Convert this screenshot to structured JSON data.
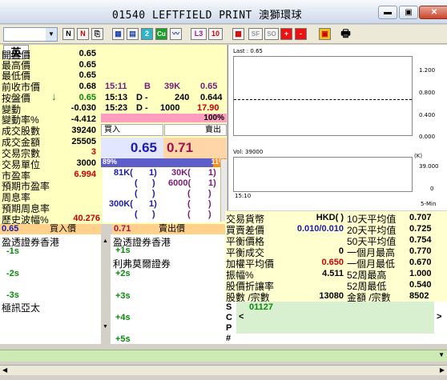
{
  "window": {
    "title": "01540 LEFTFIELD PRINT 澳獅環球",
    "min": "▬",
    "max": "▣",
    "close": "✕"
  },
  "toolbar": {
    "lang_tab": "英",
    "buttons": [
      "N",
      "⎘",
      "▦",
      "▤",
      "2",
      "Cu",
      "〰",
      "L3",
      "10",
      "▩",
      "SF",
      "SO",
      "+",
      "-",
      "▣",
      "🖶"
    ]
  },
  "quote": {
    "labels": [
      "開盤價",
      "最高價",
      "最低價",
      "前收市價",
      "按盤價",
      "變動",
      "變動率%",
      "成交股數",
      "成交金額",
      "交易宗數",
      "交易單位",
      "市盈率",
      "預期市盈率",
      "周息率",
      "預期周息率",
      "歷史波幅%"
    ],
    "values": [
      "0.65",
      "0.65",
      "0.65",
      "0.68",
      "0.65",
      "-0.030",
      "-4.412",
      "39240",
      "25505",
      "3",
      "3000",
      "6.994",
      "",
      "",
      "",
      "40.276"
    ],
    "trend_arrow": "↓",
    "trades": [
      {
        "time": "15:11",
        "side": "B",
        "vol": "39K",
        "price": "0.65"
      },
      {
        "time": "15:13",
        "side": "D -",
        "vol": "240",
        "price": "0.644"
      },
      {
        "time": "15:23",
        "side": "D -",
        "vol": "1000",
        "price": "17.90"
      }
    ],
    "bidask_pct": "100%",
    "buy_label": "買入",
    "sell_label": "賣出",
    "bid": "0.65",
    "ask": "0.71",
    "bid_ratio": "89%",
    "ask_ratio": "11%",
    "bid_ratio_value": 89,
    "queue": [
      {
        "bid": "81K(",
        "bn": "1)",
        "ask": "30K(",
        "an": "1)"
      },
      {
        "bid": "(",
        "bn": ")",
        "ask": "6000(",
        "an": "1)"
      },
      {
        "bid": "(",
        "bn": ")",
        "ask": "(",
        "an": ")"
      },
      {
        "bid": "300K(",
        "bn": "1)",
        "ask": "(",
        "an": ")"
      },
      {
        "bid": "(",
        "bn": ")",
        "ask": "(",
        "an": ")"
      }
    ]
  },
  "chart": {
    "last_label": "Last : 0.65",
    "vol_label": "Vol: 39000",
    "y_ticks": [
      "1.200",
      "0.800",
      "0.400",
      "0.000"
    ],
    "vol_unit": "(K)",
    "vol_ticks": [
      "39.000",
      "0"
    ],
    "x_label": "15:10",
    "interval": "5-Min"
  },
  "orderbar": {
    "bid_price": "0.65",
    "bid_label": "買入價",
    "ask_price": "0.71",
    "ask_label": "賣出價"
  },
  "brokers": {
    "bid_side": [
      {
        "name": "盈透證券香港",
        "tag": "-1s"
      },
      {
        "name": "",
        "tag": "-2s"
      },
      {
        "name": "",
        "tag": "-3s"
      },
      {
        "name": "極訊亞太",
        "tag": ""
      }
    ],
    "ask_side": [
      {
        "name": "盈透證券香港",
        "tag": ""
      },
      {
        "name": "",
        "tag": "+1s"
      },
      {
        "name": "利弗莫爾證券",
        "tag": ""
      },
      {
        "name": "",
        "tag": "+2s"
      },
      {
        "name": "",
        "tag": "+3s"
      },
      {
        "name": "",
        "tag": "+4s"
      },
      {
        "name": "",
        "tag": "+5s"
      }
    ]
  },
  "stats": {
    "left": [
      {
        "label": "交易貨幣",
        "value": "HKD( )"
      },
      {
        "label": "買賣差價",
        "value": "0.010/0.010"
      },
      {
        "label": "平衡價格",
        "value": ""
      },
      {
        "label": "平衡成交",
        "value": "0"
      },
      {
        "label": "加權平均價",
        "value": "0.650"
      },
      {
        "label": "振幅%",
        "value": "4.511"
      },
      {
        "label": "股價折讓率",
        "value": ""
      },
      {
        "label": "股數 /宗數",
        "value": "13080"
      }
    ],
    "right": [
      {
        "label": "10天平均值",
        "value": "0.707"
      },
      {
        "label": "20天平均值",
        "value": "0.725"
      },
      {
        "label": "50天平均值",
        "value": "0.754"
      },
      {
        "label": "一個月最高",
        "value": "0.770"
      },
      {
        "label": "一個月最低",
        "value": "0.670"
      },
      {
        "label": "52周最高",
        "value": "1.000"
      },
      {
        "label": "52周最低",
        "value": "0.540"
      },
      {
        "label": "金額 /宗數",
        "value": "8502"
      }
    ]
  },
  "scp": {
    "s": "S",
    "c": "C",
    "p": "P",
    "hash": "#",
    "code": "01127",
    "left_arrow": "<",
    "right_arrow": ">"
  },
  "colors": {
    "quote_bg": "#ffffc0",
    "bid_blue": "#1b1bb0",
    "ask_pink": "#a0124f",
    "green": "#0a8a0a",
    "red": "#cc0000"
  }
}
